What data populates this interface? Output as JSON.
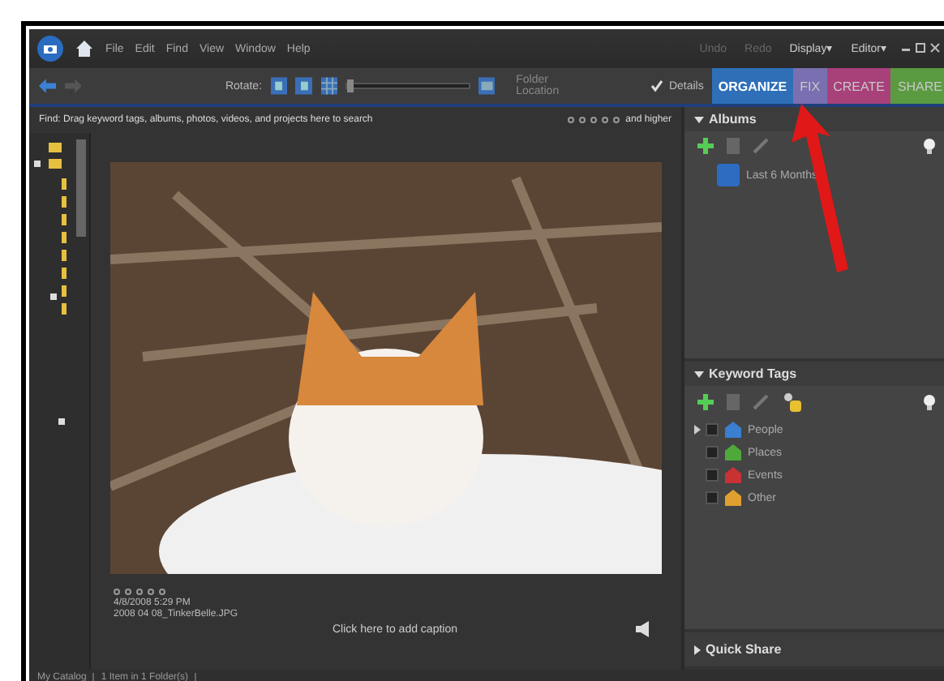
{
  "menu": [
    "File",
    "Edit",
    "Find",
    "View",
    "Window",
    "Help"
  ],
  "title_actions": [
    {
      "label": "Undo",
      "disabled": true
    },
    {
      "label": "Redo",
      "disabled": true
    },
    {
      "label": "Display▾",
      "disabled": false
    },
    {
      "label": "Editor▾",
      "disabled": false
    }
  ],
  "toolbar": {
    "rotate_label": "Rotate:",
    "zoom_slider": {
      "level": 0
    },
    "folder_location": "Folder Location",
    "details": {
      "label": "Details",
      "checked": true
    }
  },
  "tabs": [
    {
      "label": "ORGANIZE",
      "selected": true,
      "color": "#2f6fb8"
    },
    {
      "label": "FIX",
      "selected": false,
      "color": "#7a6fb0"
    },
    {
      "label": "CREATE",
      "selected": false,
      "color": "#a8407a"
    },
    {
      "label": "SHARE",
      "selected": false,
      "color": "#5a9a40"
    }
  ],
  "find_bar": {
    "text": "Find: Drag keyword tags, albums, photos, videos, and projects here to search",
    "stars": 0,
    "stars_suffix": "and higher"
  },
  "photo": {
    "stars": 0,
    "date": "4/8/2008 5:29 PM",
    "filename": "2008 04 08_TinkerBelle.JPG",
    "caption_placeholder": "Click here to add caption"
  },
  "albums": {
    "title": "Albums",
    "items": [
      {
        "label": "Last 6 Months"
      }
    ]
  },
  "keyword_tags": {
    "title": "Keyword Tags",
    "items": [
      {
        "label": "People",
        "color": "#3a7fd0",
        "checked": false,
        "expandable": true
      },
      {
        "label": "Places",
        "color": "#4fa83a",
        "checked": false,
        "expandable": false
      },
      {
        "label": "Events",
        "color": "#c83232",
        "checked": false,
        "expandable": false
      },
      {
        "label": "Other",
        "color": "#e0a030",
        "checked": false,
        "expandable": false
      }
    ]
  },
  "quick_share": {
    "title": "Quick Share"
  },
  "status_bar": [
    "My Catalog",
    "1 Item in 1 Folder(s)"
  ]
}
